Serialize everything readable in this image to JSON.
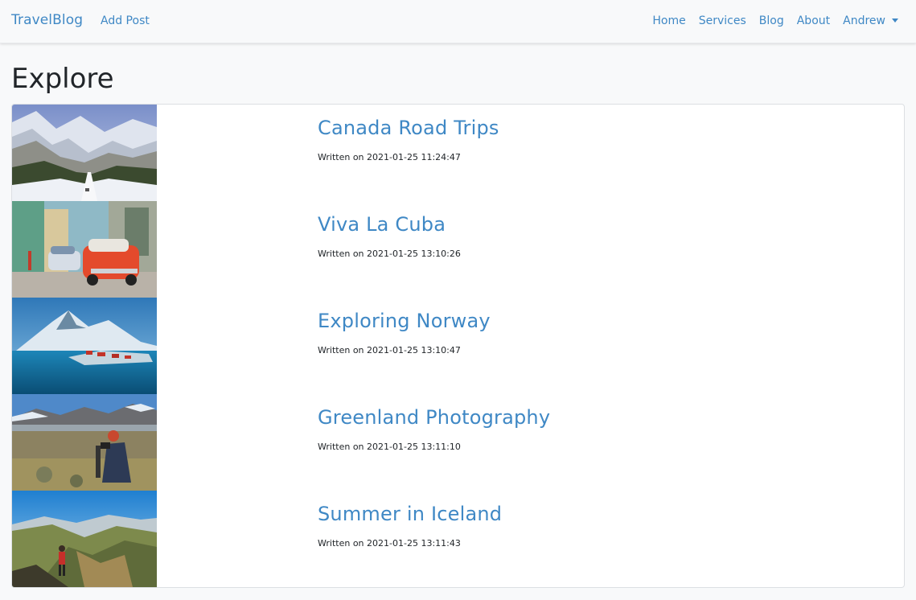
{
  "nav": {
    "brand": "TravelBlog",
    "add_post": "Add Post",
    "links": [
      "Home",
      "Services",
      "Blog",
      "About"
    ],
    "user": "Andrew",
    "link_color": "#3f88c5"
  },
  "page": {
    "title": "Explore"
  },
  "posts": [
    {
      "title": "Canada Road Trips",
      "meta": "Written on 2021-01-25 11:24:47",
      "image": "snowy-mountain-road"
    },
    {
      "title": "Viva La Cuba",
      "meta": "Written on 2021-01-25 13:10:26",
      "image": "havana-vintage-cars"
    },
    {
      "title": "Exploring Norway",
      "meta": "Written on 2021-01-25 13:10:47",
      "image": "norway-fjord-cabins"
    },
    {
      "title": "Greenland Photography",
      "meta": "Written on 2021-01-25 13:11:10",
      "image": "greenland-photographer"
    },
    {
      "title": "Summer in Iceland",
      "meta": "Written on 2021-01-25 13:11:43",
      "image": "iceland-hiker-valley"
    }
  ]
}
